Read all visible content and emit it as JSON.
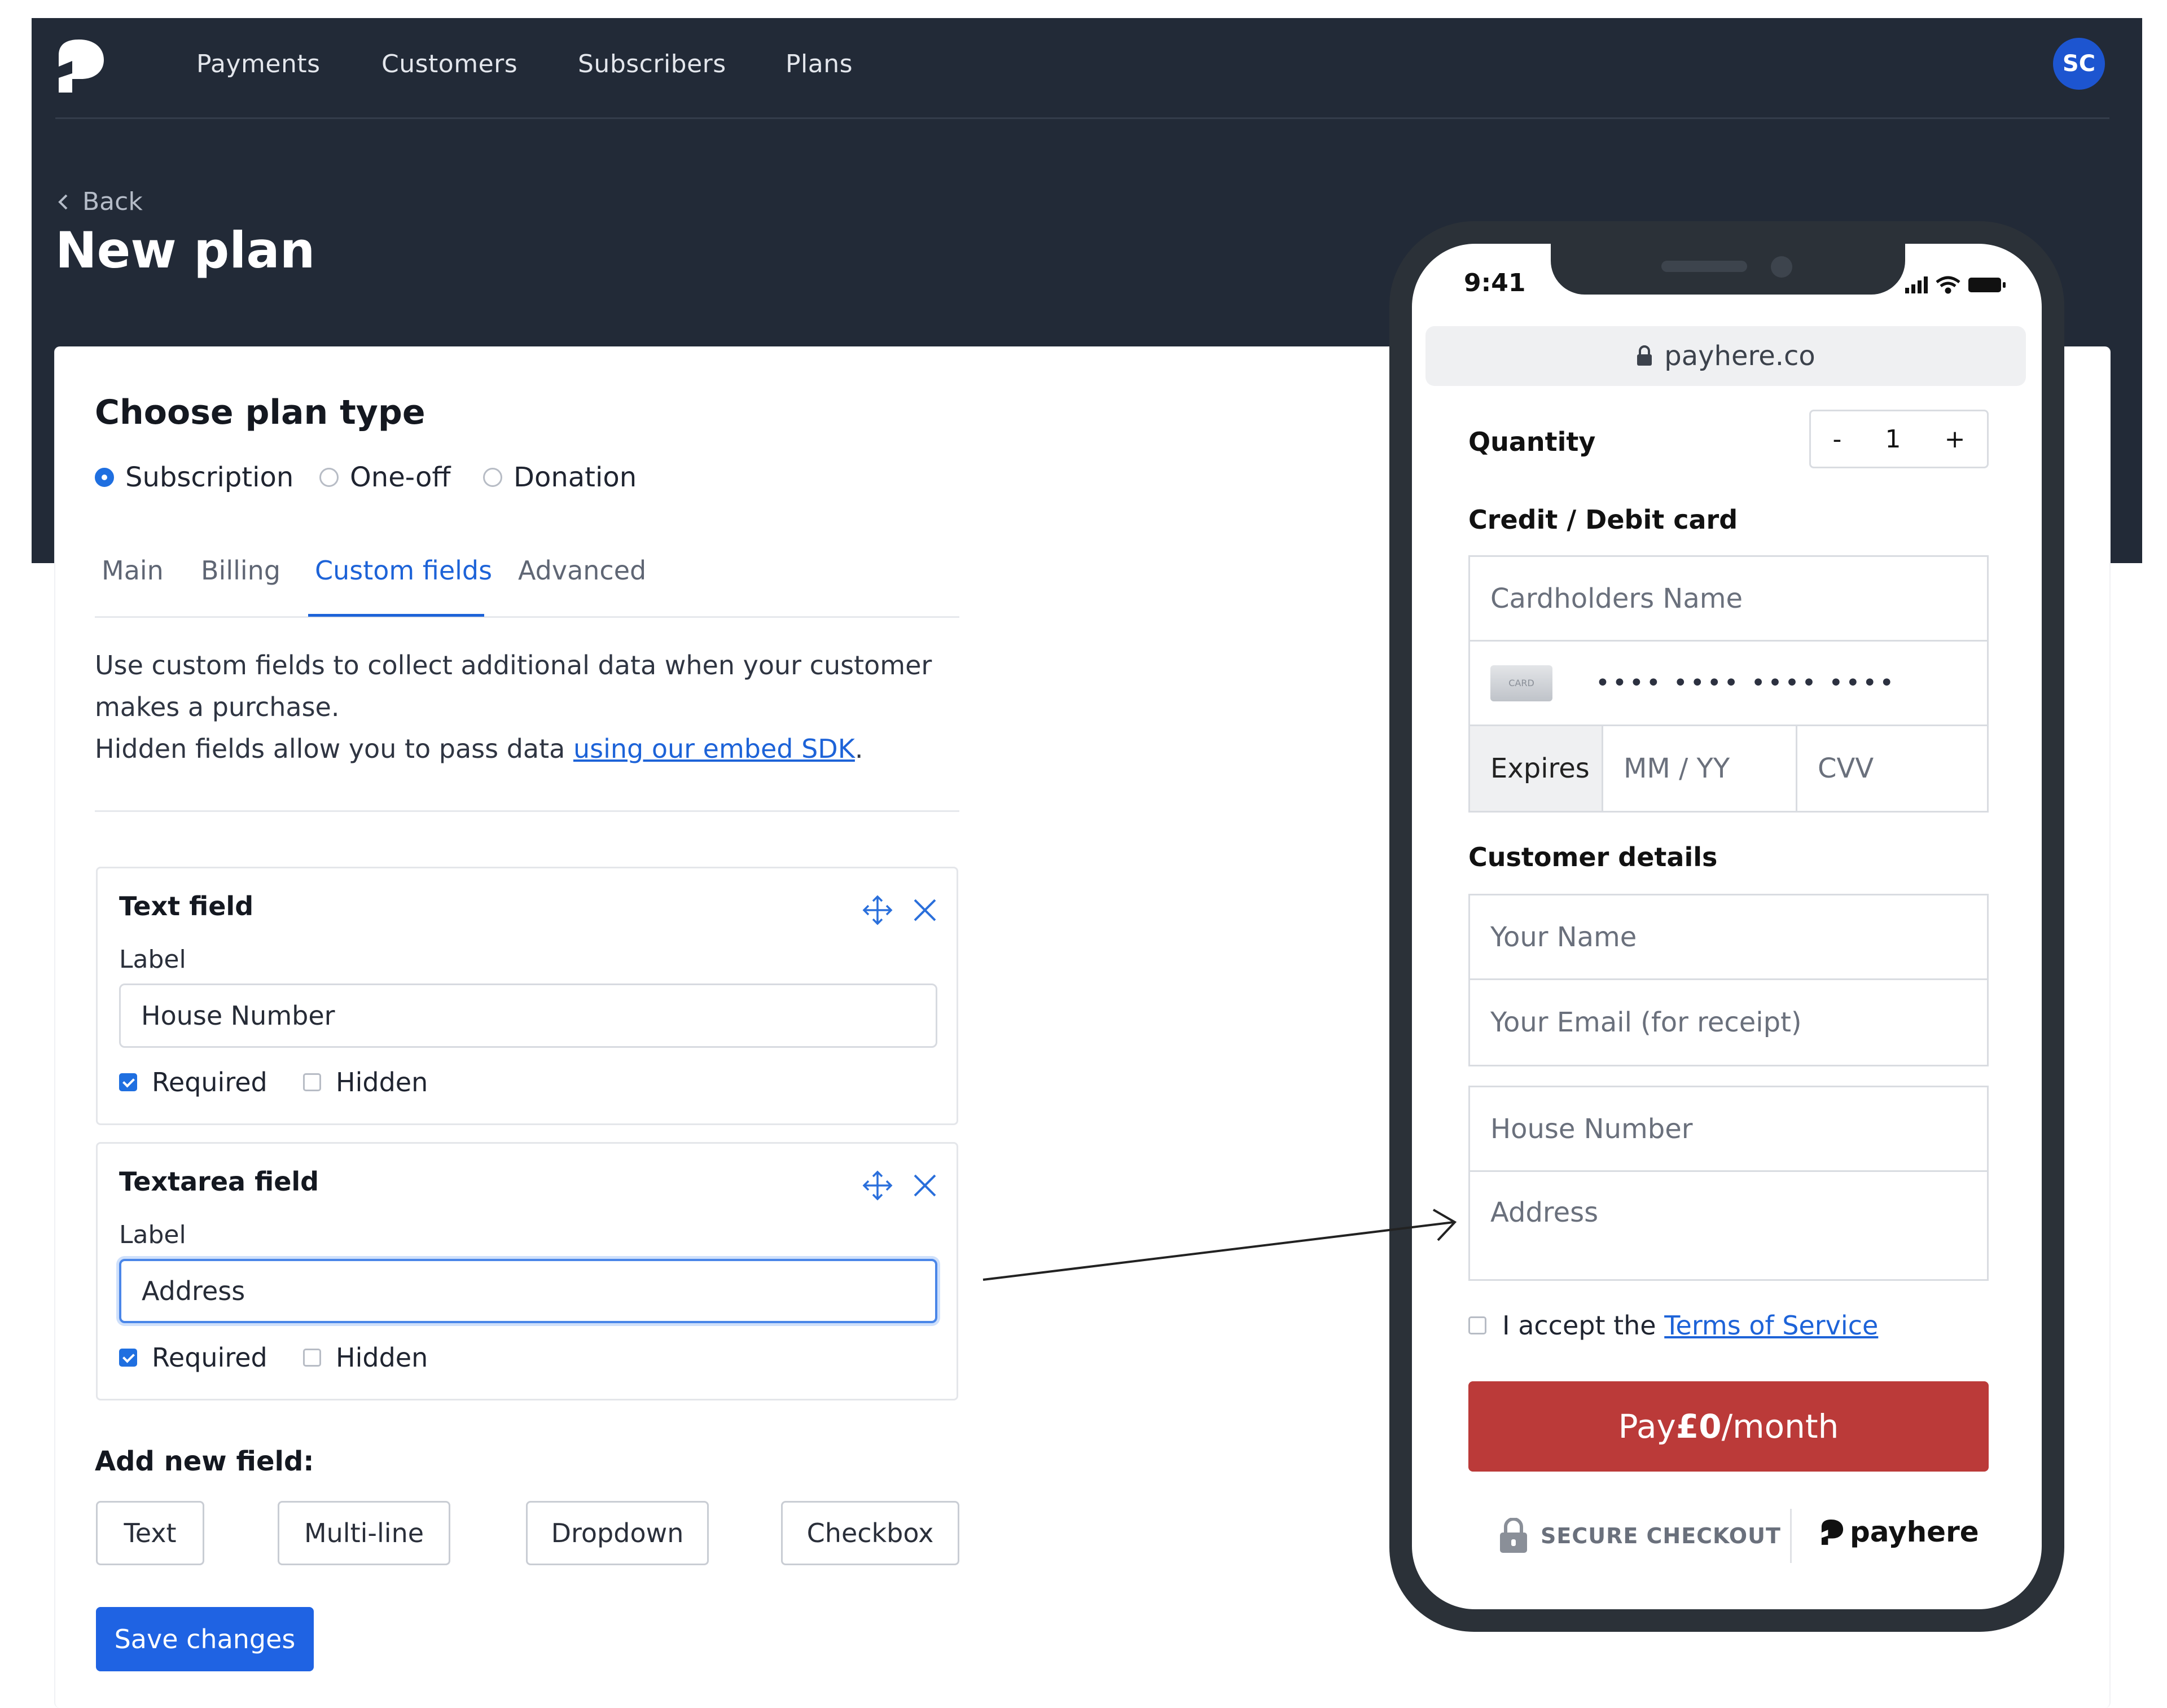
{
  "nav": {
    "items": [
      "Payments",
      "Customers",
      "Subscribers",
      "Plans"
    ],
    "avatar_initials": "SC",
    "logo_icon": "payhere-logo-icon"
  },
  "header": {
    "back_label": "Back",
    "title": "New plan"
  },
  "plan_type": {
    "heading": "Choose plan type",
    "options": [
      {
        "label": "Subscription",
        "selected": true
      },
      {
        "label": "One-off",
        "selected": false
      },
      {
        "label": "Donation",
        "selected": false
      }
    ]
  },
  "tabs": [
    {
      "label": "Main",
      "active": false
    },
    {
      "label": "Billing",
      "active": false
    },
    {
      "label": "Custom fields",
      "active": true
    },
    {
      "label": "Advanced",
      "active": false
    }
  ],
  "description": {
    "line1": "Use custom fields to collect additional data when your customer",
    "line2": "makes a purchase.",
    "line3_prefix": "Hidden fields allow you to pass data ",
    "line3_link": "using our embed SDK",
    "line3_suffix": "."
  },
  "fields": [
    {
      "title": "Text field",
      "label_caption": "Label",
      "value": "House Number",
      "required_label": "Required",
      "required": true,
      "hidden_label": "Hidden",
      "hidden": false
    },
    {
      "title": "Textarea field",
      "label_caption": "Label",
      "value": "Address",
      "required_label": "Required",
      "required": true,
      "hidden_label": "Hidden",
      "hidden": false
    }
  ],
  "add_field": {
    "title": "Add new field:",
    "buttons": [
      "Text",
      "Multi-line",
      "Dropdown",
      "Checkbox"
    ]
  },
  "save_label": "Save changes",
  "phone": {
    "time": "9:41",
    "url": "payhere.co",
    "quantity_label": "Quantity",
    "qty_minus": "-",
    "qty_value": "1",
    "qty_plus": "+",
    "card_heading": "Credit / Debit card",
    "cardholder_placeholder": "Cardholders Name",
    "card_chip_text": "CARD",
    "card_number_placeholder": "•••• •••• •••• ••••",
    "expires_label": "Expires",
    "expiry_placeholder": "MM / YY",
    "cvv_placeholder": "CVV",
    "customer_heading": "Customer details",
    "name_placeholder": "Your Name",
    "email_placeholder": "Your Email (for receipt)",
    "custom_1_placeholder": "House Number",
    "custom_2_placeholder": "Address",
    "tos_prefix": "I accept the ",
    "tos_link": "Terms of Service",
    "pay_prefix": "Pay ",
    "pay_amount": "£0",
    "pay_suffix": "/month",
    "secure_label": "SECURE CHECKOUT",
    "brand_name": "payhere"
  },
  "colors": {
    "header_bg": "#222a37",
    "accent": "#1d63d8",
    "pay_button": "#bb3a39",
    "phone_frame": "#2b3138"
  }
}
